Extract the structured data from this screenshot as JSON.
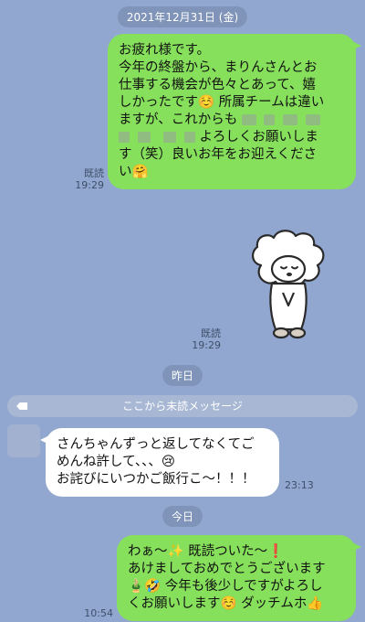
{
  "date_separators": {
    "top": "2021年12月31日 (金)",
    "yesterday": "昨日",
    "today": "今日"
  },
  "messages": {
    "m1": {
      "lines": [
        "お疲れ様です。",
        "今年の終盤から、まりんさんとお",
        "仕事する機会が色々とあって、嬉",
        "しかったです☺️ 所属チームは違い",
        "ますが、これからも",
        "よろしくお願いしま",
        "す（笑）良いお年をお迎えくださ",
        "い🤗"
      ],
      "read": "既読",
      "time": "19:29"
    },
    "sticker": {
      "read": "既読",
      "time": "19:29"
    },
    "unread_label": "ここから未読メッセージ",
    "incoming": {
      "lines": [
        "さんちゃんずっと返してなくてご",
        "めんね許して、、、😢",
        "お詫びにいつかご飯行こ〜！！！"
      ],
      "time": "23:13"
    },
    "m3": {
      "lines": [
        "わぁ〜✨ 既読ついた〜❗",
        "あけましておめでとうございます",
        "🎍🤣 今年も後少しですがよろし",
        "くお願いします☺️ ダッチムホ👍"
      ],
      "time": "10:54"
    }
  },
  "colors": {
    "background": "#91a7cf",
    "outgoing_bubble": "#86e05c",
    "incoming_bubble": "#ffffff",
    "pill": "#7f94b8"
  }
}
